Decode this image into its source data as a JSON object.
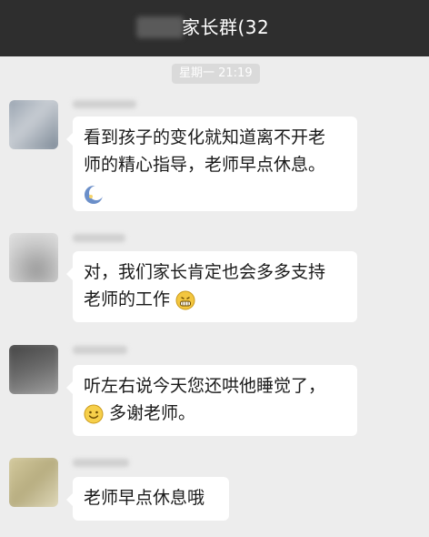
{
  "header": {
    "title": "家长群(32"
  },
  "chat": {
    "timestamp": "星期一 21:19",
    "messages": [
      {
        "line1": "看到孩子的变化就知道离不开老",
        "line2": "师的精心指导，老师早点休息。",
        "emoji": "moon-emoji-icon"
      },
      {
        "line1": "对，我们家长肯定也会多多支持",
        "line2": "老师的工作",
        "emoji": "grin-emoji-icon"
      },
      {
        "line1": "听左右说今天您还哄他睡觉了，",
        "line2": "多谢老师。",
        "emoji": "smile-emoji-icon"
      },
      {
        "line1": "老师早点休息哦"
      }
    ]
  },
  "colors": {
    "titlebar": "#2e2e2e",
    "background": "#ededed",
    "bubble": "#ffffff",
    "time_badge": "#dadada"
  }
}
